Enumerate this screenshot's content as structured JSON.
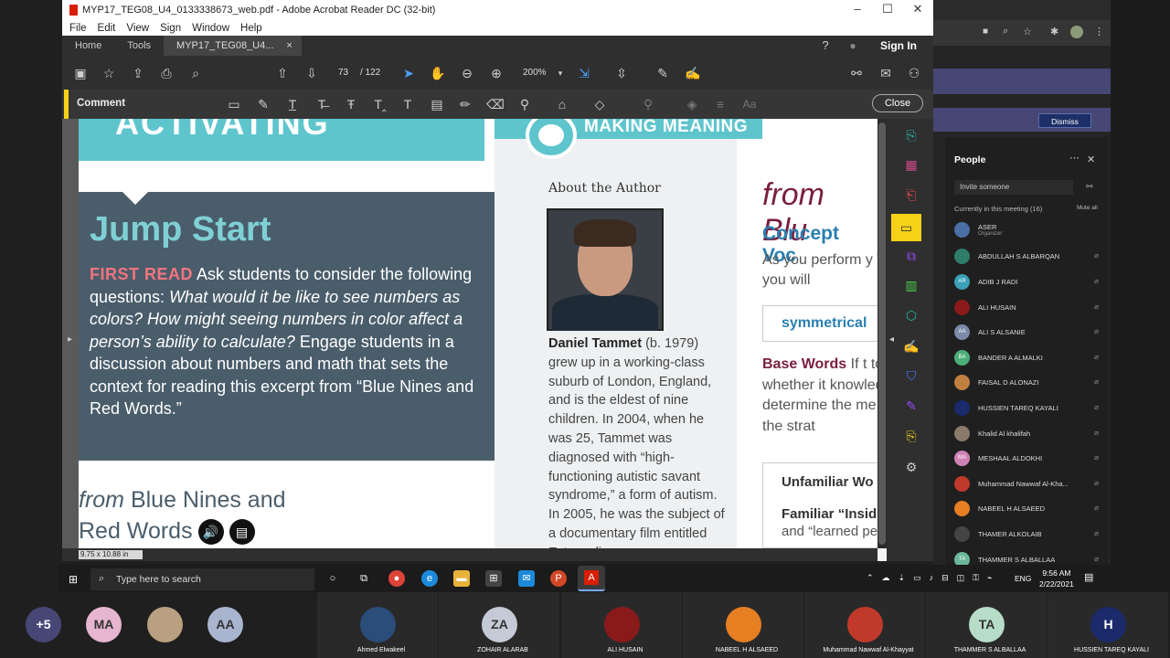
{
  "acrobat": {
    "title": "MYP17_TEG08_U4_0133338673_web.pdf - Adobe Acrobat Reader DC (32-bit)",
    "menu": [
      "File",
      "Edit",
      "View",
      "Sign",
      "Window",
      "Help"
    ],
    "tabs": {
      "home": "Home",
      "tools": "Tools",
      "doc": "MYP17_TEG08_U4...",
      "close": "×"
    },
    "signin": "Sign In",
    "page_current": "73",
    "page_total": "/ 122",
    "zoom": "200%",
    "comment_label": "Comment",
    "close_label": "Close",
    "dim": "9.75 x 10.88 in"
  },
  "page": {
    "big_title": "ACTIVATING",
    "making_meaning": "MAKING MEANING",
    "jump_start": "Jump Start",
    "first_read": "FIRST READ",
    "jump_text_1": " Ask students to consider the following questions: ",
    "jump_italic": "What would it be like to see numbers as colors? How might seeing numbers in color affect a person’s ability to calculate?",
    "jump_text_2": " Engage students in a discussion about numbers and math that sets the context for reading this excerpt from “Blue Nines and Red Words.”",
    "from": "from",
    "blue_nines_1": " Blue Nines and",
    "blue_nines_2": "Red Words",
    "about_author": "About the Author",
    "author_name": "Daniel Tammet",
    "bio": " (b. 1979) grew up in a working-class suburb of London, England, and is the eldest of nine children. In 2004, when he was 25, Tammet was diagnosed with “high-functioning autistic savant syndrome,” a form of autism. In 2005, he was the subject of a documentary film entitled Extraordinary",
    "from_blu": "from Blu",
    "concept_voc": "Concept Voc",
    "as_you": "As you perform y Words,” you will",
    "symmetrical": "symmetrical",
    "base_words_label": "Base Words",
    "base_words_text": " If t to see whether it knowledge of the determine the me to apply the strat",
    "unfamiliar": "Unfamiliar Wo",
    "familiar": "Familiar “Insid",
    "learned": "and “learned pe"
  },
  "teams": {
    "dismiss": "Dismiss",
    "people": "People",
    "invite": "Invite someone",
    "in_meeting": "Currently in this meeting (16)",
    "mute_all": "Mute all",
    "participants": [
      {
        "name": "ASER",
        "sub": "Organizer",
        "color": "#4a6fa5"
      },
      {
        "name": "ABDULLAH S ALBARQAN",
        "color": "#2e7d6b"
      },
      {
        "name": "ADIB J RADI",
        "color": "#3aa0b5",
        "init": "AR"
      },
      {
        "name": "ALI HUSAIN",
        "color": "#8a1a1a"
      },
      {
        "name": "ALI S ALSANIE",
        "color": "#7a8aa8",
        "init": "AA"
      },
      {
        "name": "BANDER A ALMALKI",
        "color": "#4caf78",
        "init": "BA"
      },
      {
        "name": "FAISAL D ALONAZI",
        "color": "#c08040"
      },
      {
        "name": "HUSSIEN TAREQ KAYALI",
        "color": "#1b2a6b"
      },
      {
        "name": "Khalid Al khalifah",
        "color": "#8a7a6a"
      },
      {
        "name": "MESHAAL ALDOKHI",
        "color": "#d081b5",
        "init": "MA"
      },
      {
        "name": "Muhammad Nawwaf Al-Kha...",
        "color": "#c0392b"
      },
      {
        "name": "NABEEL H ALSAEED",
        "color": "#e67e22"
      },
      {
        "name": "THAMER ALKOLAIB",
        "color": "#444"
      },
      {
        "name": "THAMMER S ALBALLAA",
        "color": "#6ab79a",
        "init": "TA"
      }
    ]
  },
  "taskbar": {
    "search": "Type here to search",
    "lang": "ENG",
    "time": "9:56 AM",
    "date": "2/22/2021"
  },
  "bottom": {
    "tiles": [
      {
        "init": "+5",
        "color": "#464775",
        "name": ""
      },
      {
        "init": "MA",
        "color": "#e6b5cf",
        "name": ""
      },
      {
        "init": "",
        "color": "#b8a080",
        "name": ""
      },
      {
        "init": "AA",
        "color": "#a9b5cf",
        "name": ""
      },
      {
        "init": "",
        "color": "#1f1f1f",
        "name": ""
      },
      {
        "init": "",
        "color": "#2a4d7a",
        "name": "Ahmed Elwakeel"
      },
      {
        "init": "ZA",
        "color": "#c5cbd6",
        "name": "ZOHAIR  ALARAB"
      },
      {
        "init": "",
        "color": "#8a1a1a",
        "name": "ALI  HUSAIN"
      },
      {
        "init": "",
        "color": "#e67e22",
        "name": "NABEEL H ALSAEED"
      },
      {
        "init": "",
        "color": "#c0392b",
        "name": "Muhammad Nawwaf  Al-Khayyat"
      },
      {
        "init": "TA",
        "color": "#b7dcc8",
        "name": "THAMMER S ALBALLAA"
      },
      {
        "init": "H",
        "color": "#1b2a6b",
        "name": "HUSSIEN TAREQ  KAYALI"
      }
    ]
  }
}
